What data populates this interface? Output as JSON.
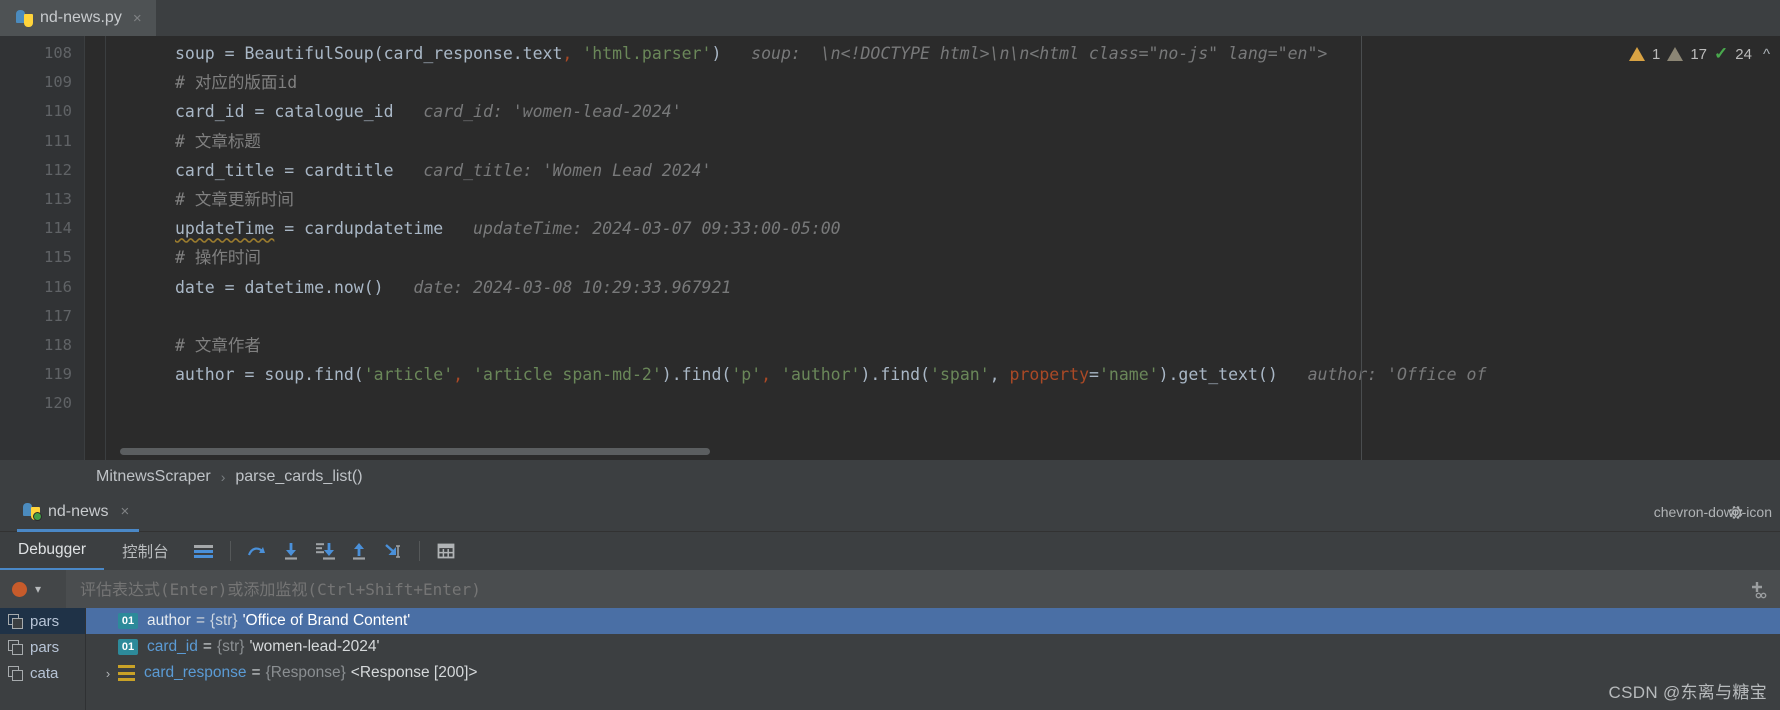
{
  "editor": {
    "tab": {
      "filename": "nd-news.py",
      "close_label": "×",
      "icon": "python-file-icon"
    },
    "inspections": {
      "warning_count": "1",
      "weak_warning_count": "17",
      "ok_count": "24",
      "collapse_icon": "chevron-up-icon"
    },
    "line_numbers": [
      "108",
      "109",
      "110",
      "111",
      "112",
      "113",
      "114",
      "115",
      "116",
      "117",
      "118",
      "119",
      "120"
    ],
    "lines": [
      {
        "number": "108",
        "segments": [
          {
            "text": "soup = BeautifulSoup(card_response.text",
            "cls": "kw-default"
          },
          {
            "text": ",",
            "cls": "named-arg"
          },
          {
            "text": " ",
            "cls": "kw-default"
          },
          {
            "text": "'html.parser'",
            "cls": "str"
          },
          {
            "text": ")",
            "cls": "kw-default"
          }
        ],
        "hint": "soup:  \\n<!DOCTYPE html>\\n\\n<html class=\"no-js\" lang=\"en\">"
      },
      {
        "number": "109",
        "segments": [
          {
            "text": "# 对应的版面id",
            "cls": "comment"
          }
        ],
        "hint": ""
      },
      {
        "number": "110",
        "segments": [
          {
            "text": "card_id = catalogue_id",
            "cls": "kw-default"
          }
        ],
        "hint": "card_id: 'women-lead-2024'"
      },
      {
        "number": "111",
        "segments": [
          {
            "text": "# 文章标题",
            "cls": "comment"
          }
        ],
        "hint": ""
      },
      {
        "number": "112",
        "segments": [
          {
            "text": "card_title = cardtitle",
            "cls": "kw-default"
          }
        ],
        "hint": "card_title: 'Women Lead 2024'"
      },
      {
        "number": "113",
        "segments": [
          {
            "text": "# 文章更新时间",
            "cls": "comment"
          }
        ],
        "hint": ""
      },
      {
        "number": "114",
        "segments": [
          {
            "text": "updateTime",
            "cls": "squiggle"
          },
          {
            "text": " = cardupdatetime",
            "cls": "kw-default"
          }
        ],
        "hint": "updateTime: 2024-03-07 09:33:00-05:00"
      },
      {
        "number": "115",
        "segments": [
          {
            "text": "# 操作时间",
            "cls": "comment"
          }
        ],
        "hint": ""
      },
      {
        "number": "116",
        "segments": [
          {
            "text": "date = datetime.now()",
            "cls": "kw-default"
          }
        ],
        "hint": "date: 2024-03-08 10:29:33.967921"
      },
      {
        "number": "117",
        "segments": [],
        "hint": ""
      },
      {
        "number": "118",
        "segments": [
          {
            "text": "# 文章作者",
            "cls": "comment"
          }
        ],
        "hint": ""
      },
      {
        "number": "119",
        "segments": [
          {
            "text": "author = soup.find(",
            "cls": "kw-default"
          },
          {
            "text": "'article'",
            "cls": "str"
          },
          {
            "text": ",",
            "cls": "named-arg"
          },
          {
            "text": " ",
            "cls": "kw-default"
          },
          {
            "text": "'article span-md-2'",
            "cls": "str"
          },
          {
            "text": ").find(",
            "cls": "kw-default"
          },
          {
            "text": "'p'",
            "cls": "str"
          },
          {
            "text": ",",
            "cls": "named-arg"
          },
          {
            "text": " ",
            "cls": "kw-default"
          },
          {
            "text": "'author'",
            "cls": "str"
          },
          {
            "text": ").find(",
            "cls": "kw-default"
          },
          {
            "text": "'span'",
            "cls": "str"
          },
          {
            "text": ", ",
            "cls": "kw-default"
          },
          {
            "text": "property",
            "cls": "named-arg"
          },
          {
            "text": "=",
            "cls": "kw-default"
          },
          {
            "text": "'name'",
            "cls": "str"
          },
          {
            "text": ").get_text()",
            "cls": "kw-default"
          }
        ],
        "hint": "author: 'Office of"
      },
      {
        "number": "120",
        "segments": [],
        "hint": ""
      }
    ]
  },
  "breadcrumb": {
    "items": [
      "MitnewsScraper",
      "parse_cards_list()"
    ],
    "separator": "›"
  },
  "debug": {
    "run_tab": {
      "label": "nd-news",
      "close_label": "×",
      "icon": "python-run-icon"
    },
    "settings_icon": "gear-icon",
    "settings_chevron": "chevron-down-icon",
    "tabs": [
      {
        "label": "Debugger",
        "active": true
      },
      {
        "label": "控制台",
        "active": false
      }
    ],
    "toolbar_buttons": [
      {
        "name": "show-frames-icon",
        "label": ""
      },
      {
        "name": "step-over-icon",
        "label": ""
      },
      {
        "name": "step-into-icon",
        "label": ""
      },
      {
        "name": "force-step-into-icon",
        "label": ""
      },
      {
        "name": "step-out-icon",
        "label": ""
      },
      {
        "name": "run-to-cursor-icon",
        "label": ""
      },
      {
        "name": "evaluate-expression-icon",
        "label": ""
      }
    ],
    "evaluate": {
      "placeholder": "评估表达式(Enter)或添加监视(Ctrl+Shift+Enter)",
      "value": "",
      "breakpoint_icon": "breakpoint-dot-icon",
      "dropdown_icon": "chevron-down-icon",
      "add_watch_icon": "add-watch-icon"
    },
    "frames": [
      {
        "label": "pars",
        "selected": true
      },
      {
        "label": "pars",
        "selected": false
      },
      {
        "label": "cata",
        "selected": false
      }
    ],
    "variables": [
      {
        "expander": "",
        "badge": "01",
        "name": "author",
        "type": "{str}",
        "value": "'Office of Brand Content'",
        "selected": true
      },
      {
        "expander": "",
        "badge": "01",
        "name": "card_id",
        "type": "{str}",
        "value": "'women-lead-2024'",
        "selected": false
      },
      {
        "expander": "›",
        "badge": "obj",
        "name": "card_response",
        "type": "{Response}",
        "value": "<Response [200]>",
        "selected": false
      }
    ]
  },
  "watermark": {
    "text": "CSDN @东离与糖宝"
  },
  "colors": {
    "editor_bg": "#2b2b2b",
    "panel_bg": "#3c3f41",
    "accent_blue": "#4a88c7",
    "selection_blue": "#4a6fa5",
    "string_green": "#6a8759",
    "warning_orange": "#d9a343",
    "ok_green": "#49a94d"
  }
}
